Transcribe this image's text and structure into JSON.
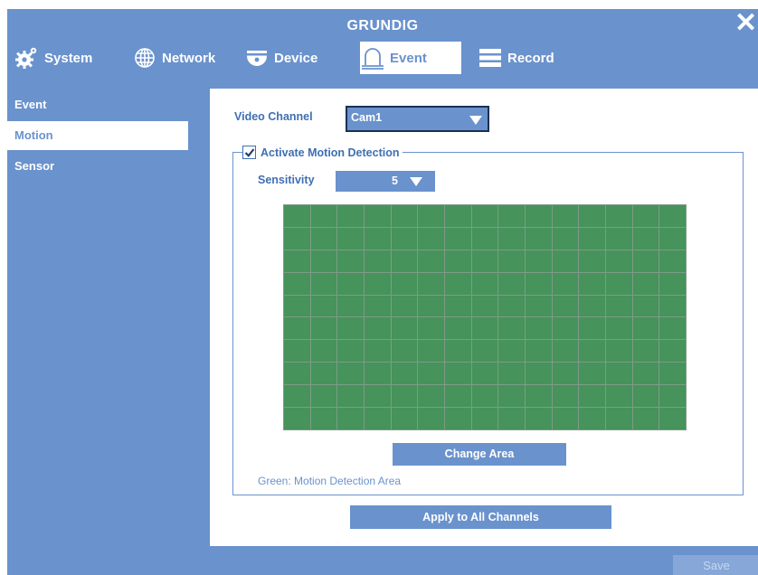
{
  "window": {
    "title": "GRUNDIG",
    "close_glyph": "✕"
  },
  "tabs": [
    {
      "label": "System",
      "icon": "gear-icon",
      "active": false
    },
    {
      "label": "Network",
      "icon": "globe-icon",
      "active": false
    },
    {
      "label": "Device",
      "icon": "camera-icon",
      "active": false
    },
    {
      "label": "Event",
      "icon": "bell-icon",
      "active": true
    },
    {
      "label": "Record",
      "icon": "record-icon",
      "active": false
    }
  ],
  "sidebar": {
    "items": [
      {
        "label": "Event",
        "active": false
      },
      {
        "label": "Motion",
        "active": true
      },
      {
        "label": "Sensor",
        "active": false
      }
    ]
  },
  "form": {
    "video_channel_label": "Video Channel",
    "video_channel_value": "Cam1",
    "activate_label": "Activate Motion Detection",
    "activate_checked": true,
    "sensitivity_label": "Sensitivity",
    "sensitivity_value": "5",
    "grid": {
      "columns": 15,
      "rows": 10,
      "color": "#46935b"
    },
    "change_area_label": "Change Area",
    "note": "Green: Motion Detection Area",
    "apply_all_label": "Apply to All Channels"
  },
  "footer": {
    "save_label": "Save"
  },
  "colors": {
    "accent": "#6a92cd",
    "text_blue": "#3f6fb3",
    "motion_green": "#46935b"
  }
}
